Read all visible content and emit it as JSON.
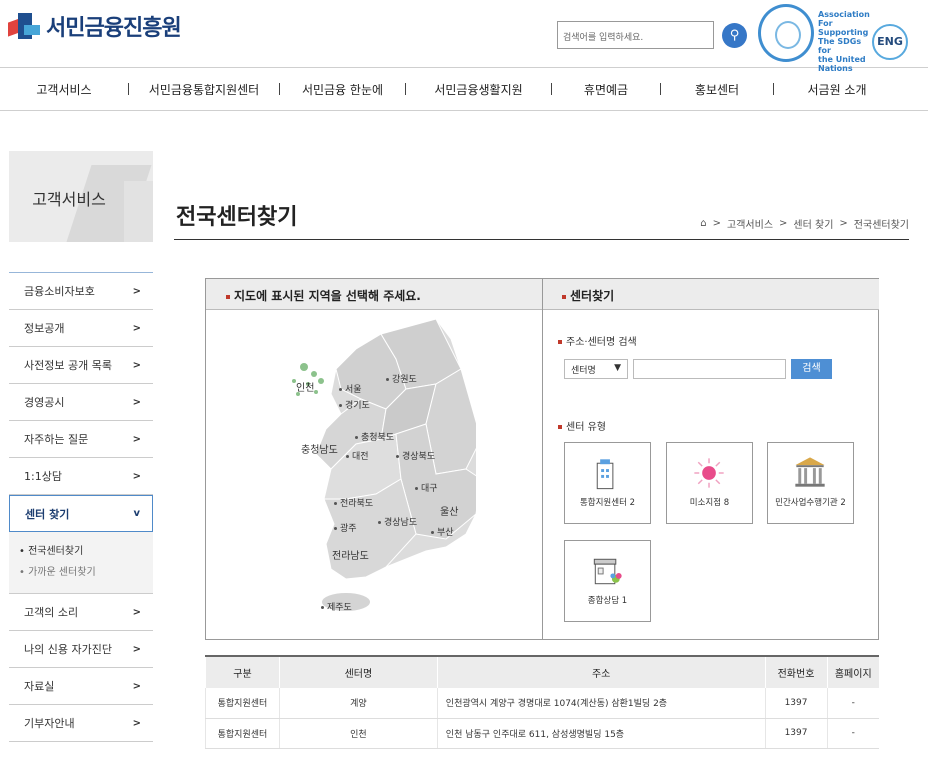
{
  "header": {
    "logo_text": "서민금융진흥원",
    "search_placeholder": "검색어를 입력하세요.",
    "sdg_text": [
      "Association",
      "For Supporting",
      "The SDGs for",
      "the United",
      "Nations"
    ],
    "eng_label": "ENG"
  },
  "gnb": [
    "고객서비스",
    "서민금융통합지원센터",
    "서민금융 한눈에",
    "서민금융생활지원",
    "휴면예금",
    "홍보센터",
    "서금원 소개"
  ],
  "lnb": {
    "title": "고객서비스",
    "items": [
      "금융소비자보호",
      "정보공개",
      "사전정보 공개 목록",
      "경영공시",
      "자주하는 질문",
      "1:1상담"
    ],
    "active": "센터 찾기",
    "sub": [
      "전국센터찾기",
      "가까운 센터찾기"
    ],
    "items_after": [
      "고객의 소리",
      "나의 신용 자가진단",
      "자료실",
      "기부자안내"
    ]
  },
  "page": {
    "title": "전국센터찾기",
    "breadcrumb": [
      "고객서비스",
      "센터 찾기",
      "전국센터찾기"
    ]
  },
  "map_panel": {
    "header": "지도에 표시된 지역을 선택해 주세요.",
    "regions": [
      "인천",
      "서울",
      "강원도",
      "경기도",
      "충청북도",
      "충청남도",
      "대전",
      "경상북도",
      "대구",
      "전라북도",
      "울산",
      "광주",
      "경상남도",
      "부산",
      "전라남도",
      "제주도"
    ]
  },
  "search_panel": {
    "header": "센터찾기",
    "address_label": "주소·센터명 검색",
    "select_value": "센터명",
    "button": "검색",
    "type_label": "센터 유형",
    "types": [
      {
        "label": "통합지원센터",
        "count": "2"
      },
      {
        "label": "미소지점",
        "count": "8"
      },
      {
        "label": "민간사업수행기관",
        "count": "2"
      },
      {
        "label": "종합상담",
        "count": "1"
      }
    ]
  },
  "table": {
    "headers": [
      "구분",
      "센터명",
      "주소",
      "전화번호",
      "홈페이지"
    ],
    "rows": [
      [
        "통합지원센터",
        "계양",
        "인천광역시 계양구 경명대로 1074(계산동) 삼환1빌딩 2층",
        "1397",
        "-"
      ],
      [
        "통합지원센터",
        "인천",
        "인천 남동구 인주대로 611, 삼성생명빌딩 15층",
        "1397",
        "-"
      ]
    ]
  }
}
